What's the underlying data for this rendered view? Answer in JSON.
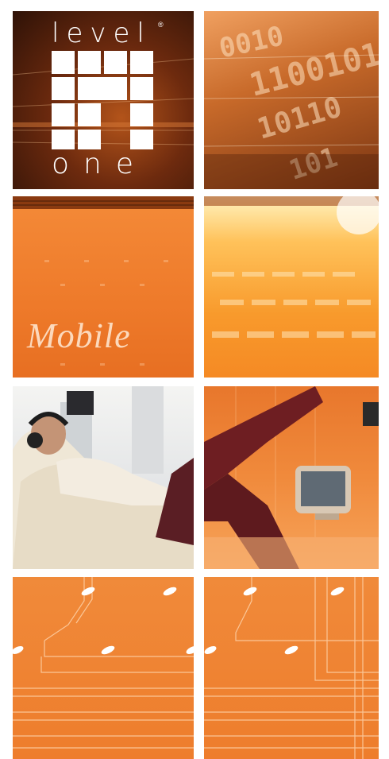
{
  "brand": {
    "top": "level",
    "bottom": "one",
    "registered": "®"
  },
  "panels": {
    "mobile_text": "Mobile"
  },
  "binary_text": "0010110010110101",
  "colors": {
    "orange": "#ee7d2c",
    "dark_brown": "#3a1608",
    "white": "#ffffff"
  }
}
